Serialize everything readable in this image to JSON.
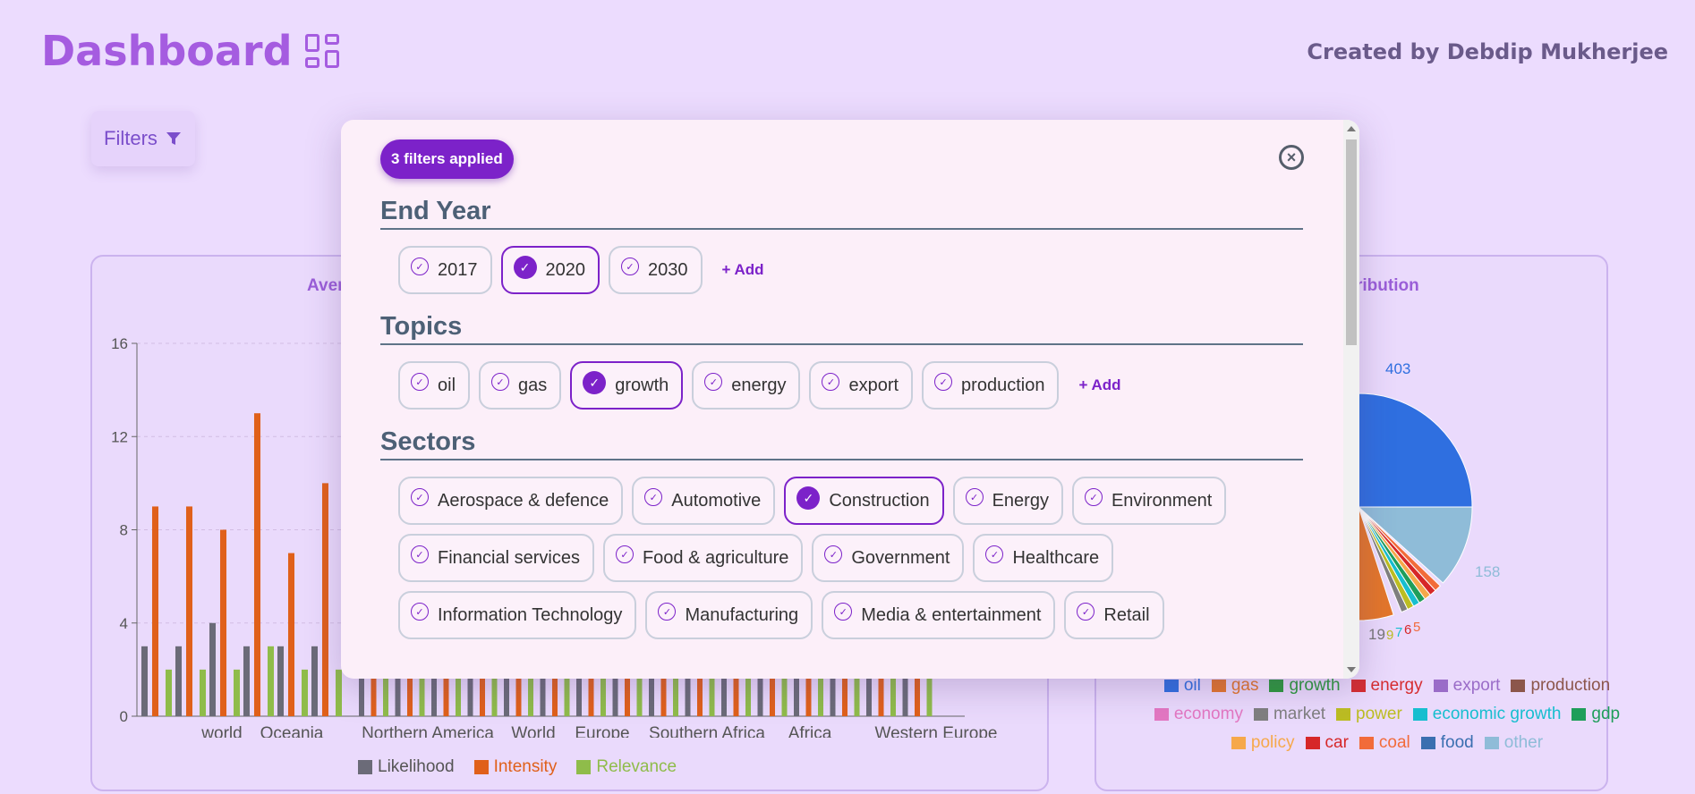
{
  "header": {
    "title": "Dashboard",
    "created_by": "Created by Debdip Mukherjee"
  },
  "filters_button": {
    "label": "Filters"
  },
  "left_card": {
    "title": "Aver",
    "chart_data": {
      "type": "bar",
      "categories": [
        "",
        "world",
        "Oceania",
        "",
        "",
        "Northern America",
        "World",
        "Europe",
        "Southern Africa",
        "Africa",
        "Western Europe"
      ],
      "series": [
        {
          "name": "Likelihood",
          "color": "#6b6b78",
          "values": [
            3,
            3,
            4,
            3,
            3,
            3
          ]
        },
        {
          "name": "Intensity",
          "color": "#e0601a",
          "values": [
            9,
            9,
            8,
            13,
            7,
            10
          ]
        },
        {
          "name": "Relevance",
          "color": "#8fbc4a",
          "values": [
            2,
            2,
            2,
            3,
            2,
            2
          ]
        }
      ],
      "ylim": [
        0,
        16
      ],
      "yticks": [
        "0",
        "4",
        "8",
        "12",
        "16"
      ],
      "xtick_labels": [
        "world",
        "Oceania",
        "Northern America",
        "World",
        "Europe",
        "Southern Africa",
        "Africa",
        "Western Europe"
      ],
      "legend": [
        "Likelihood",
        "Intensity",
        "Relevance"
      ]
    }
  },
  "right_card": {
    "title": "ribution",
    "chart_data": {
      "type": "pie",
      "visible_labels": [
        "403",
        "158",
        "19",
        "9",
        "7",
        "6",
        "5"
      ],
      "legend": [
        {
          "label": "oil",
          "color": "#2f6fe0"
        },
        {
          "label": "gas",
          "color": "#e3762a"
        },
        {
          "label": "growth",
          "color": "#2b9a3a"
        },
        {
          "label": "energy",
          "color": "#d62d30"
        },
        {
          "label": "export",
          "color": "#9a6cc8"
        },
        {
          "label": "production",
          "color": "#8c564b"
        },
        {
          "label": "economy",
          "color": "#e377c2"
        },
        {
          "label": "market",
          "color": "#7f7f7f"
        },
        {
          "label": "power",
          "color": "#bcbd22"
        },
        {
          "label": "economic growth",
          "color": "#17becf"
        },
        {
          "label": "gdp",
          "color": "#1f9e5a"
        },
        {
          "label": "policy",
          "color": "#f6a84a"
        },
        {
          "label": "car",
          "color": "#d62728"
        },
        {
          "label": "coal",
          "color": "#f26b3a"
        },
        {
          "label": "food",
          "color": "#3a6fb0"
        },
        {
          "label": "other",
          "color": "#8fbcd8"
        }
      ]
    }
  },
  "modal": {
    "badge": "3 filters applied",
    "close_icon": "close-circle-icon",
    "sections": {
      "end_year": {
        "title": "End Year",
        "add": "+ Add",
        "chips": [
          {
            "label": "2017",
            "selected": false
          },
          {
            "label": "2020",
            "selected": true
          },
          {
            "label": "2030",
            "selected": false
          }
        ]
      },
      "topics": {
        "title": "Topics",
        "add": "+ Add",
        "chips": [
          {
            "label": "oil",
            "selected": false
          },
          {
            "label": "gas",
            "selected": false
          },
          {
            "label": "growth",
            "selected": true
          },
          {
            "label": "energy",
            "selected": false
          },
          {
            "label": "export",
            "selected": false
          },
          {
            "label": "production",
            "selected": false
          }
        ]
      },
      "sectors": {
        "title": "Sectors",
        "chips": [
          {
            "label": "Aerospace & defence",
            "selected": false
          },
          {
            "label": "Automotive",
            "selected": false
          },
          {
            "label": "Construction",
            "selected": true
          },
          {
            "label": "Energy",
            "selected": false
          },
          {
            "label": "Environment",
            "selected": false
          },
          {
            "label": "Financial services",
            "selected": false
          },
          {
            "label": "Food & agriculture",
            "selected": false
          },
          {
            "label": "Government",
            "selected": false
          },
          {
            "label": "Healthcare",
            "selected": false
          },
          {
            "label": "Information Technology",
            "selected": false
          },
          {
            "label": "Manufacturing",
            "selected": false
          },
          {
            "label": "Media & entertainment",
            "selected": false
          },
          {
            "label": "Retail",
            "selected": false
          }
        ]
      }
    }
  }
}
